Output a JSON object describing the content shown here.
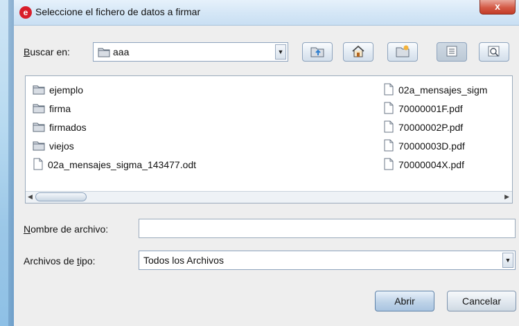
{
  "window": {
    "title": "Seleccione el fichero de datos a firmar",
    "close_glyph": "x",
    "logo_letter": "e"
  },
  "lookin": {
    "label_mnemonic": "B",
    "label_rest": "uscar en:",
    "value": "aaa"
  },
  "toolbar_icons": [
    "up-folder-icon",
    "home-icon",
    "new-folder-icon",
    "list-view-icon",
    "details-view-icon"
  ],
  "files": {
    "column1": [
      {
        "name": "ejemplo",
        "type": "folder"
      },
      {
        "name": "firma",
        "type": "folder"
      },
      {
        "name": "firmados",
        "type": "folder"
      },
      {
        "name": "viejos",
        "type": "folder"
      },
      {
        "name": "02a_mensajes_sigma_143477.odt",
        "type": "file"
      }
    ],
    "column2": [
      {
        "name": "02a_mensajes_sigm",
        "type": "file"
      },
      {
        "name": "70000001F.pdf",
        "type": "file"
      },
      {
        "name": "70000002P.pdf",
        "type": "file"
      },
      {
        "name": "70000003D.pdf",
        "type": "file"
      },
      {
        "name": "70000004X.pdf",
        "type": "file"
      }
    ]
  },
  "filename": {
    "label_mnemonic": "N",
    "label_rest": "ombre de archivo:",
    "value": ""
  },
  "filetype": {
    "label_before": "Archivos de ",
    "label_mnemonic": "t",
    "label_after": "ipo:",
    "value": "Todos los Archivos"
  },
  "buttons": {
    "open": "Abrir",
    "cancel": "Cancelar"
  },
  "colors": {
    "accent": "#d81e2b",
    "titlebar": "#d4e6f6",
    "close": "#c23c27"
  }
}
